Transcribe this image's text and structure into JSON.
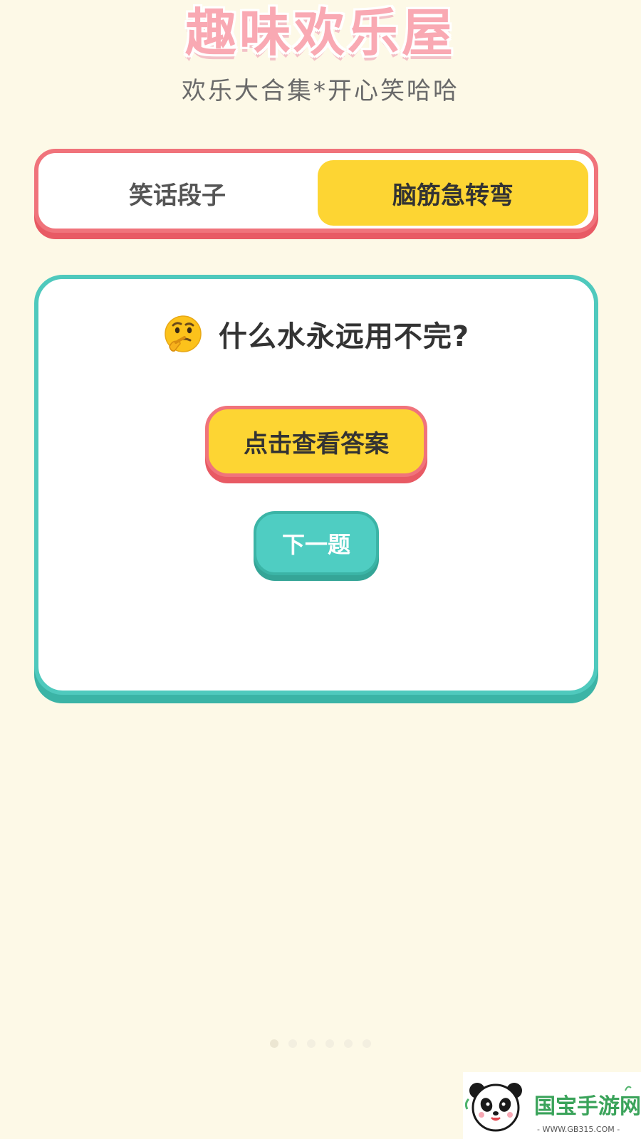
{
  "header": {
    "title": "趣味欢乐屋",
    "subtitle": "欢乐大合集*开心笑哈哈"
  },
  "tabs": [
    {
      "label": "笑话段子",
      "selected": false
    },
    {
      "label": "脑筋急转弯",
      "selected": true
    }
  ],
  "card": {
    "icon": "thinking-face-icon",
    "question": "什么水永远用不完?",
    "answer_button_label": "点击查看答案",
    "next_button_label": "下一题"
  },
  "pagination": {
    "dot_count": 6,
    "active_index": 0
  },
  "watermark": {
    "text": "国宝手游网",
    "url": "- WWW.GB315.COM -"
  },
  "colors": {
    "background": "#fdf9e7",
    "title_pink": "#f9a9b3",
    "tab_border_red": "#f0737b",
    "accent_yellow": "#fdd533",
    "card_border_teal": "#4fc9bd",
    "next_button_teal": "#4fcdc2"
  }
}
